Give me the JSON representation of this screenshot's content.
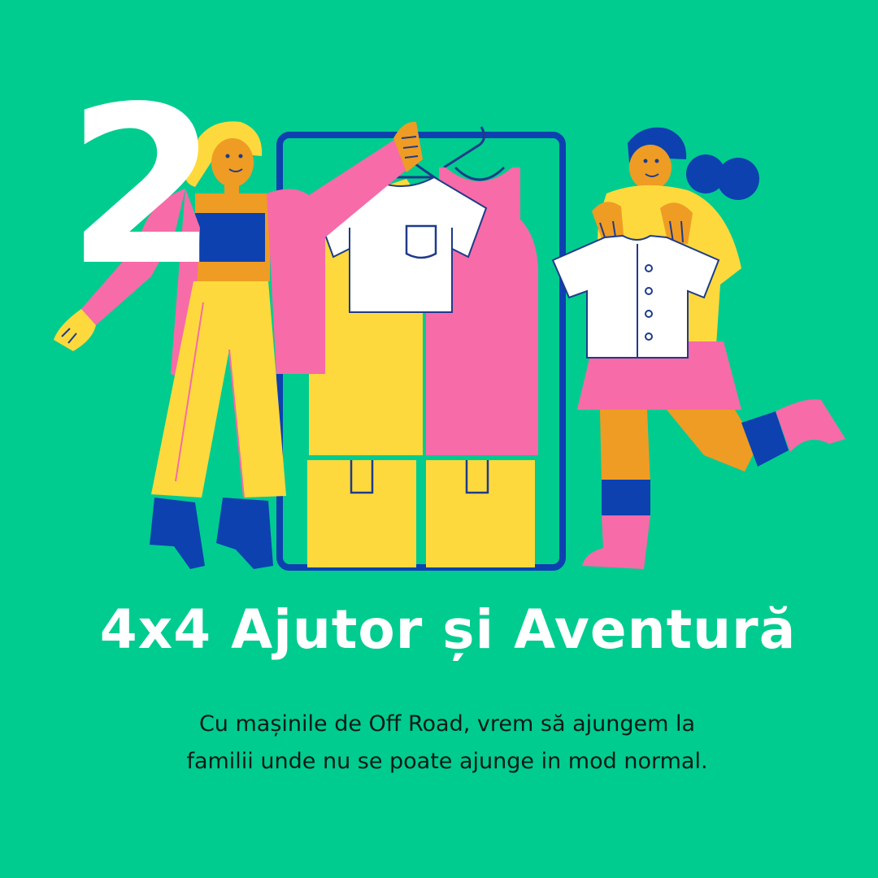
{
  "step_number": "2",
  "headline": "4x4 Ajutor și Aventură",
  "body_lines": [
    "Cu mașinile de Off Road, vrem să ajungem la",
    "familii unde nu se poate ajunge in mod normal."
  ],
  "colors": {
    "background": "#00CC90",
    "pink": "#F76BA8",
    "yellow": "#FED93D",
    "blue": "#0D41B0",
    "orange": "#EF9C24",
    "white": "#FFFFFF",
    "outline": "#1E3B8A"
  },
  "illustration": {
    "scene": "two-women-with-clothes-rack",
    "items": [
      "white-tshirt",
      "pink-dress",
      "white-shirt",
      "yellow-boxes"
    ]
  }
}
